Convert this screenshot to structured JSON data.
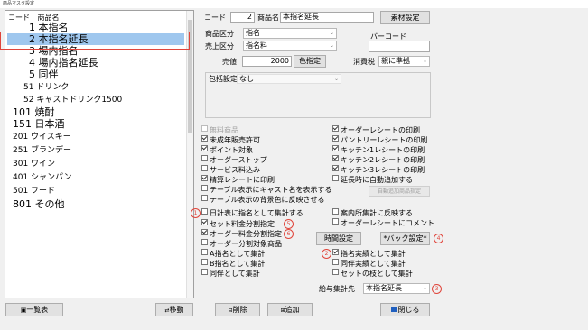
{
  "window": {
    "title": "商品マスタ設定"
  },
  "list": {
    "header_code": "コード",
    "header_name": "商品名",
    "items": [
      {
        "text": "1 本指名"
      },
      {
        "text": "2 本指名延長"
      },
      {
        "text": "3 場内指名"
      },
      {
        "text": "4 場内指名延長"
      },
      {
        "text": "5 同伴"
      },
      {
        "text": "51 ドリンク"
      },
      {
        "text": "52 キャストドリンク1500"
      },
      {
        "text": "101 焼酎"
      },
      {
        "text": "151 日本酒"
      },
      {
        "text": "201 ウイスキー"
      },
      {
        "text": "251 ブランデー"
      },
      {
        "text": "301 ワイン"
      },
      {
        "text": "401 シャンパン"
      },
      {
        "text": "501 フード"
      },
      {
        "text": "801 その他"
      }
    ]
  },
  "form": {
    "code_label": "コード",
    "code_value": "2",
    "name_label": "商品名",
    "name_value": "本指名延長",
    "material_button": "素材設定",
    "category_label": "商品区分",
    "category_value": "指名",
    "sales_category_label": "売上区分",
    "sales_category_value": "指名料",
    "barcode_label": "バーコード",
    "barcode_value": "",
    "price_label": "売値",
    "price_value": "2000",
    "color_button": "色指定",
    "tax_label": "消費税",
    "tax_value": "親に準拠",
    "package_label": "包括設定",
    "package_value": "なし"
  },
  "checks_left": [
    {
      "label": "無料商品",
      "checked": false,
      "dim": true
    },
    {
      "label": "未成年販売許可",
      "checked": true,
      "dim": false
    },
    {
      "label": "ポイント対象",
      "checked": true,
      "dim": false
    },
    {
      "label": "オーダーストップ",
      "checked": false,
      "dim": false
    },
    {
      "label": "サービス料込み",
      "checked": false,
      "dim": false
    },
    {
      "label": "精算レシートに印刷",
      "checked": true,
      "dim": false
    },
    {
      "label": "テーブル表示にキャスト名を表示する",
      "checked": false,
      "dim": false
    },
    {
      "label": "テーブル表示の背景色に反映させる",
      "checked": false,
      "dim": false
    },
    {
      "label": "日計表に指名として集計する",
      "checked": false,
      "dim": false
    },
    {
      "label": "セット料金分割指定",
      "checked": true,
      "dim": false
    },
    {
      "label": "オーダー料金分割指定",
      "checked": true,
      "dim": false
    },
    {
      "label": "オーダー分割対象商品",
      "checked": false,
      "dim": false
    },
    {
      "label": "A指名として集計",
      "checked": false,
      "dim": false
    },
    {
      "label": "B指名として集計",
      "checked": false,
      "dim": false
    },
    {
      "label": "同伴として集計",
      "checked": false,
      "dim": false
    }
  ],
  "checks_right_top": [
    {
      "label": "オーダーレシートの印刷",
      "checked": true
    },
    {
      "label": "パントリーレシートの印刷",
      "checked": true
    },
    {
      "label": "キッチン1レシートの印刷",
      "checked": true
    },
    {
      "label": "キッチン2レシートの印刷",
      "checked": true
    },
    {
      "label": "キッチン3レシートの印刷",
      "checked": true
    },
    {
      "label": "延長時に自動追加する",
      "checked": false
    }
  ],
  "auto_add_button": "自動追加商品指定",
  "checks_right_mid": [
    {
      "label": "案内所集計に反映する",
      "checked": false
    },
    {
      "label": "オーダーレシートにコメント",
      "checked": false
    }
  ],
  "time_button": "時間設定",
  "back_button": "*バック設定*",
  "checks_right_bottom": [
    {
      "label": "指名実績として集計",
      "checked": true
    },
    {
      "label": "同伴実績として集計",
      "checked": false
    },
    {
      "label": "セットの枝として集計",
      "checked": false
    }
  ],
  "salary_label": "給与集計先",
  "salary_value": "本指名延長",
  "annotations": [
    "1",
    "2",
    "3",
    "4",
    "5",
    "6"
  ],
  "bottom": {
    "list_button": "一覧表",
    "move_button": "移動",
    "delete_button": "削除",
    "add_button": "追加",
    "close_button": "閉じる"
  },
  "colors": {
    "selection": "#9fc7ee",
    "annotation": "#e0453b",
    "close_icon": "#1f5fbf"
  }
}
